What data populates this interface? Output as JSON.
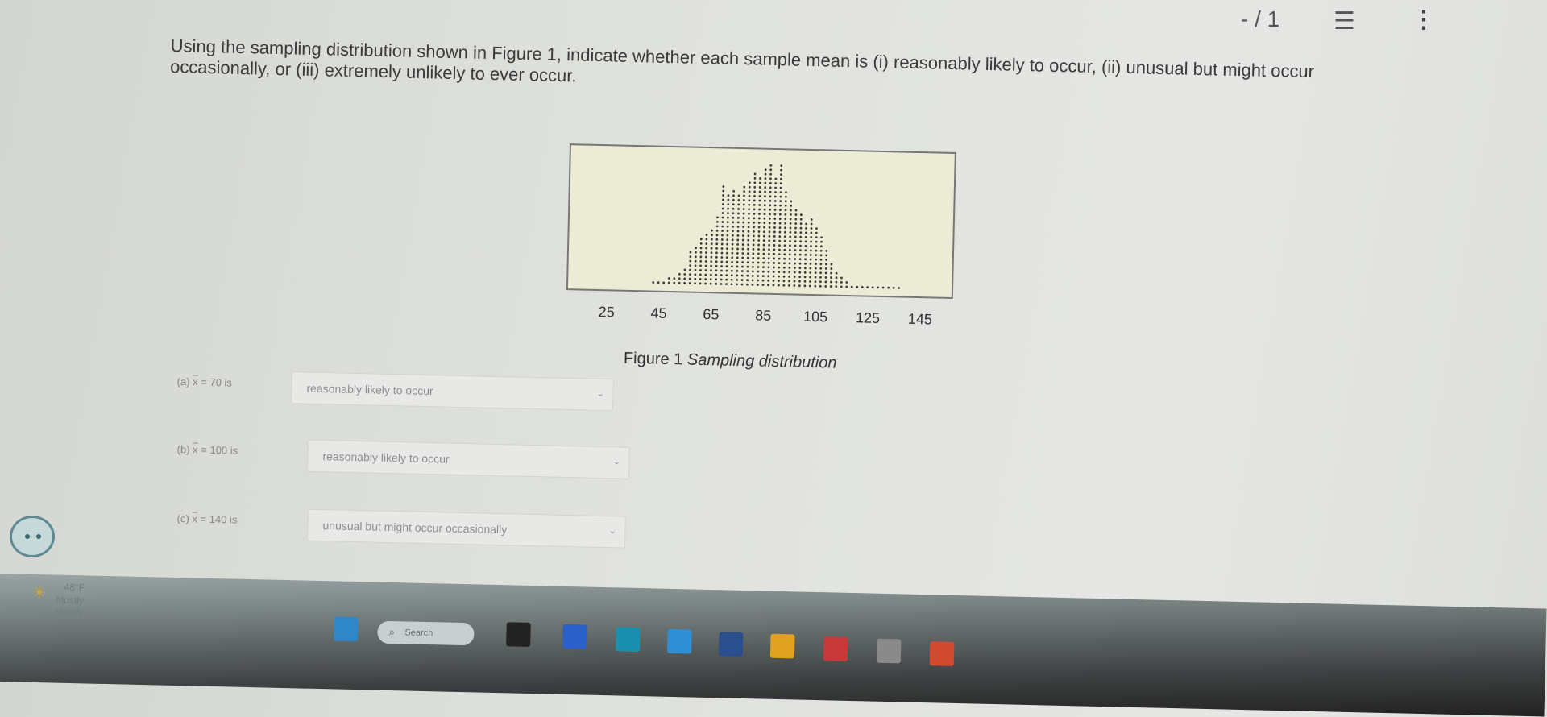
{
  "toolbar": {
    "page_indicator": "- / 1",
    "toc_icon": "list-icon",
    "more_icon": "more-vertical-icon"
  },
  "question": {
    "text": "Using the sampling distribution shown in Figure 1, indicate whether each sample mean is (i) reasonably likely to occur, (ii) unusual but might occur occasionally, or (iii) extremely unlikely to ever occur."
  },
  "figure": {
    "caption_prefix": "Figure 1 ",
    "caption_italic": "Sampling distribution"
  },
  "chart_data": {
    "type": "scatter",
    "subtype": "dot-plot",
    "x_ticks": [
      25,
      45,
      65,
      85,
      105,
      125,
      145
    ],
    "xlim": [
      15,
      150
    ],
    "title": "",
    "xlabel": "",
    "ylabel": "",
    "grid": false,
    "dot_color": "#3a3a3a",
    "background": "#ecebd6",
    "column_counts": [
      {
        "x": 42,
        "count": 1
      },
      {
        "x": 44,
        "count": 1
      },
      {
        "x": 46,
        "count": 1
      },
      {
        "x": 48,
        "count": 2
      },
      {
        "x": 50,
        "count": 2
      },
      {
        "x": 52,
        "count": 3
      },
      {
        "x": 54,
        "count": 4
      },
      {
        "x": 56,
        "count": 8
      },
      {
        "x": 58,
        "count": 9
      },
      {
        "x": 60,
        "count": 11
      },
      {
        "x": 62,
        "count": 12
      },
      {
        "x": 64,
        "count": 13
      },
      {
        "x": 66,
        "count": 16
      },
      {
        "x": 68,
        "count": 23
      },
      {
        "x": 70,
        "count": 21
      },
      {
        "x": 72,
        "count": 22
      },
      {
        "x": 74,
        "count": 21
      },
      {
        "x": 76,
        "count": 23
      },
      {
        "x": 78,
        "count": 24
      },
      {
        "x": 80,
        "count": 26
      },
      {
        "x": 82,
        "count": 25
      },
      {
        "x": 84,
        "count": 27
      },
      {
        "x": 86,
        "count": 28
      },
      {
        "x": 88,
        "count": 25
      },
      {
        "x": 90,
        "count": 28
      },
      {
        "x": 92,
        "count": 22
      },
      {
        "x": 94,
        "count": 20
      },
      {
        "x": 96,
        "count": 18
      },
      {
        "x": 98,
        "count": 17
      },
      {
        "x": 100,
        "count": 15
      },
      {
        "x": 102,
        "count": 16
      },
      {
        "x": 104,
        "count": 14
      },
      {
        "x": 106,
        "count": 12
      },
      {
        "x": 108,
        "count": 9
      },
      {
        "x": 110,
        "count": 6
      },
      {
        "x": 112,
        "count": 4
      },
      {
        "x": 114,
        "count": 3
      },
      {
        "x": 116,
        "count": 2
      },
      {
        "x": 118,
        "count": 1
      },
      {
        "x": 120,
        "count": 1
      },
      {
        "x": 122,
        "count": 1
      },
      {
        "x": 124,
        "count": 1
      },
      {
        "x": 126,
        "count": 1
      },
      {
        "x": 128,
        "count": 1
      },
      {
        "x": 130,
        "count": 1
      },
      {
        "x": 132,
        "count": 1
      },
      {
        "x": 134,
        "count": 1
      },
      {
        "x": 136,
        "count": 1
      }
    ]
  },
  "parts": [
    {
      "label_prefix": "(a) ",
      "xbar": "x",
      "label_suffix": " = 70 is",
      "answer": "reasonably likely to occur"
    },
    {
      "label_prefix": "(b) ",
      "xbar": "x",
      "label_suffix": " = 100 is",
      "answer": "reasonably likely to occur"
    },
    {
      "label_prefix": "(c) ",
      "xbar": "x",
      "label_suffix": " = 140 is",
      "answer": "unusual but might occur occasionally"
    }
  ],
  "taskbar": {
    "temperature": "48°F",
    "condition": "Mostly cloudy",
    "search_placeholder": "Search",
    "search_icon": "search-icon",
    "icons": [
      {
        "name": "widgets-icon",
        "color": "#2f86c8"
      },
      {
        "name": "file-explorer-icon",
        "color": "#222222"
      },
      {
        "name": "chat-icon",
        "color": "#2a62c9"
      },
      {
        "name": "edge-icon",
        "color": "#1b8fae"
      },
      {
        "name": "store-icon",
        "color": "#2e8fd4"
      },
      {
        "name": "app-icon",
        "color": "#2a4f8c"
      },
      {
        "name": "folder-icon",
        "color": "#e0a21e"
      },
      {
        "name": "mail-icon",
        "color": "#c8373a"
      },
      {
        "name": "app-icon-2",
        "color": "#8a8a8a"
      },
      {
        "name": "chrome-icon",
        "color": "#d24a2f"
      }
    ]
  }
}
